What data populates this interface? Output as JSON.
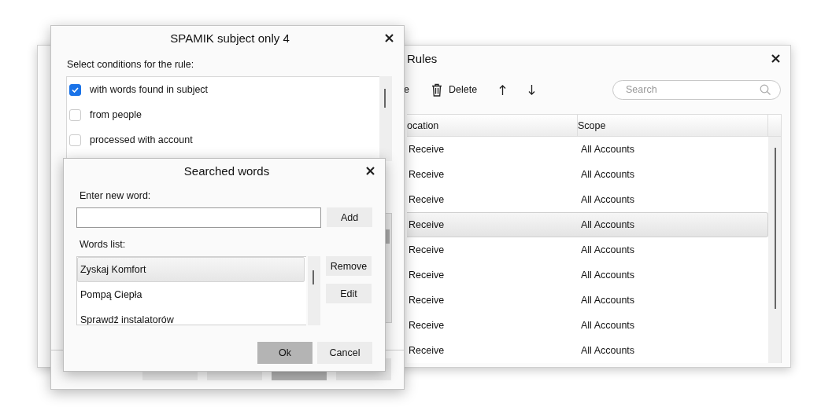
{
  "rules_window": {
    "title": "Rules",
    "toolbar": [
      {
        "kind": "text",
        "label": "e"
      },
      {
        "kind": "delete",
        "label": "Delete"
      },
      {
        "kind": "up"
      },
      {
        "kind": "down"
      }
    ],
    "search": {
      "placeholder": "Search"
    },
    "table": {
      "columns": [
        "ocation",
        "Scope"
      ],
      "rows": [
        {
          "cells": [
            "Receive",
            "All Accounts"
          ],
          "selected": false
        },
        {
          "cells": [
            "Receive",
            "All Accounts"
          ],
          "selected": false
        },
        {
          "cells": [
            "Receive",
            "All Accounts"
          ],
          "selected": false
        },
        {
          "cells": [
            "Receive",
            "All Accounts"
          ],
          "selected": true
        },
        {
          "cells": [
            "Receive",
            "All Accounts"
          ],
          "selected": false
        },
        {
          "cells": [
            "Receive",
            "All Accounts"
          ],
          "selected": false
        },
        {
          "cells": [
            "Receive",
            "All Accounts"
          ],
          "selected": false
        },
        {
          "cells": [
            "Receive",
            "All Accounts"
          ],
          "selected": false
        },
        {
          "cells": [
            "Receive",
            "All Accounts"
          ],
          "selected": false
        }
      ]
    }
  },
  "rule_dialog": {
    "title": "SPAMIK subject only 4",
    "conditions_label": "Select conditions for the rule:",
    "conditions": [
      {
        "label": "with words found in subject",
        "checked": true
      },
      {
        "label": "from people",
        "checked": false
      },
      {
        "label": "processed with account",
        "checked": false
      }
    ],
    "buttons": [
      {
        "default": false
      },
      {
        "default": false
      },
      {
        "default": true
      },
      {
        "default": false
      }
    ]
  },
  "words_dialog": {
    "title": "Searched words",
    "new_word_label": "Enter new word:",
    "add_button": "Add",
    "list_label": "Words list:",
    "words": [
      {
        "label": "Zyskaj Komfort",
        "selected": true
      },
      {
        "label": "Pompą Ciepła",
        "selected": false
      },
      {
        "label": "Sprawdź instalatorów",
        "selected": false
      }
    ],
    "side_buttons": [
      "Remove",
      "Edit"
    ],
    "buttons": [
      {
        "label": "Ok",
        "default": true
      },
      {
        "label": "Cancel",
        "default": false
      }
    ]
  }
}
